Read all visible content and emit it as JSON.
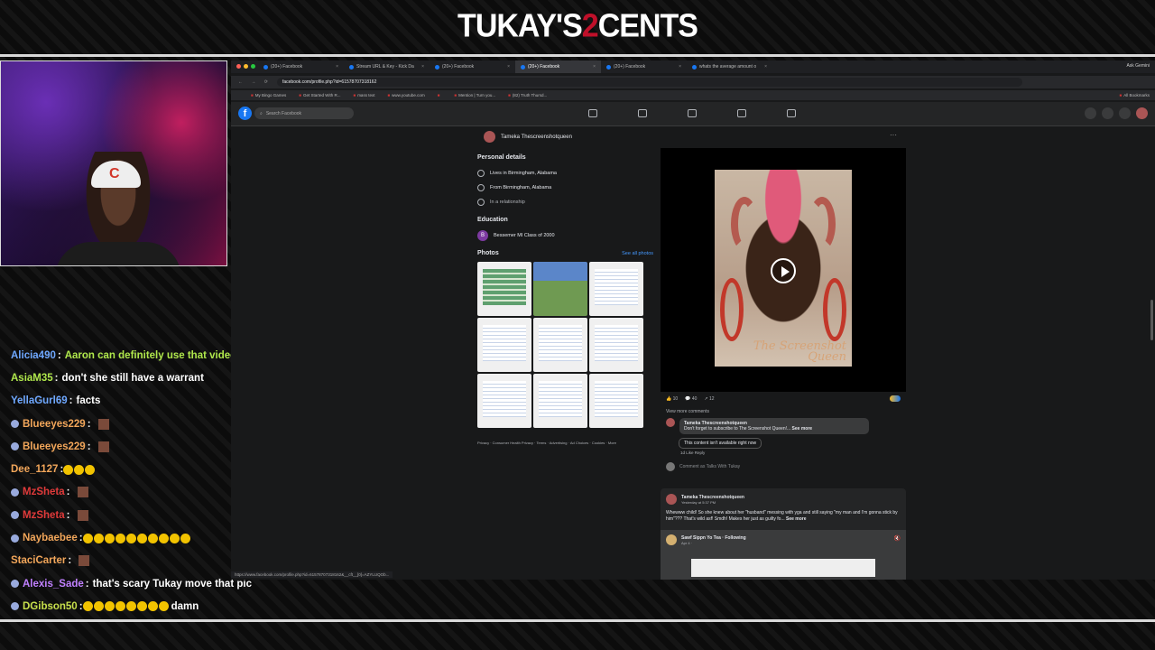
{
  "stream": {
    "title_part1": "TUKAY'S",
    "title_part2": "2",
    "title_part3": "CENTS",
    "webcam_cap_logo": "C"
  },
  "chat": [
    {
      "user": "Alicia490",
      "text": "Aaron can definitely use that video against her !!!!!!!!",
      "user_color": "#6fa8ff",
      "text_color": "#ffffff",
      "emoji_count": 0,
      "badge": false
    },
    {
      "user": "AsiaM35",
      "text": "don't she still have a warrant",
      "user_color": "#b0e84c",
      "emoji_count": 0,
      "badge": false
    },
    {
      "user": "YellaGurl69",
      "text": "facts",
      "user_color": "#6fa8ff",
      "emoji_count": 0,
      "badge": false
    },
    {
      "user": "Blueeyes229",
      "text": "",
      "user_color": "#f2a65a",
      "emoji_count": 0,
      "badge": true,
      "emote": true
    },
    {
      "user": "Blueeyes229",
      "text": "",
      "user_color": "#f2a65a",
      "emoji_count": 0,
      "badge": true,
      "emote": true
    },
    {
      "user": "Dee_1127",
      "text": "",
      "user_color": "#f2a65a",
      "emoji_count": 3,
      "badge": false
    },
    {
      "user": "MzSheta",
      "text": "",
      "user_color": "#e03a3a",
      "emoji_count": 0,
      "badge": true,
      "emote": true
    },
    {
      "user": "MzSheta",
      "text": "",
      "user_color": "#e03a3a",
      "emoji_count": 0,
      "badge": true,
      "emote": true
    },
    {
      "user": "Naybaebee",
      "text": "",
      "user_color": "#f2a65a",
      "emoji_count": 10,
      "badge": true
    },
    {
      "user": "StaciCarter",
      "text": "",
      "user_color": "#f2a65a",
      "emoji_count": 0,
      "badge": false,
      "emote": true
    },
    {
      "user": "Alexis_Sade",
      "text": "that's scary Tukay move that pic",
      "user_color": "#c080ff",
      "emoji_count": 0,
      "badge": true
    },
    {
      "user": "DGibson50",
      "text": "damn",
      "user_color": "#c8e04c",
      "emoji_count": 8,
      "badge": true
    }
  ],
  "browser": {
    "tabs": [
      {
        "label": "(20+) Facebook",
        "active": false
      },
      {
        "label": "Stream URL & Key - Kick Da",
        "active": false
      },
      {
        "label": "(20+) Facebook",
        "active": false
      },
      {
        "label": "(20+) Facebook",
        "active": true
      },
      {
        "label": "(20+) Facebook",
        "active": false
      },
      {
        "label": "whats the average amount o",
        "active": false
      }
    ],
    "ask_gemini": "Ask Gemini",
    "url": "facebook.com/profile.php?id=61578707318162",
    "bookmarks": [
      "My Bingo Games",
      "Get Started With R...",
      "mass text",
      "www.youtube.com",
      "",
      "Mention | Turn you...",
      "(82) Truth Thursd..."
    ],
    "all_bookmarks": "All Bookmarks",
    "status_url": "https://www.facebook.com/profile.php?id=61578707318162&__cft__[0]=AZYLUQOb..."
  },
  "facebook": {
    "logo": "f",
    "search_placeholder": "Search Facebook",
    "profile_name": "Tameka Thescreenshotqueen",
    "personal_details_title": "Personal details",
    "details": [
      "Lives in Birmingham, Alabama",
      "From Birmingham, Alabama",
      "In a relationship"
    ],
    "education_title": "Education",
    "education_badge": "B",
    "education": "Bessemer MI Class of 2000",
    "photos_title": "Photos",
    "see_all_photos": "See all photos",
    "footer": "Privacy · Consumer Health Privacy · Terms · Advertising · Ad Choices · Cookies · More",
    "video_watermark": "The Screenshot Queen",
    "stats": {
      "likes": "10",
      "comments": "40",
      "shares": "12"
    },
    "view_more_comments": "View more comments",
    "comment_author": "Tameka Thescreenshotqueen",
    "comment_text": "Don't forget to subscribe to The Screenshot Queen!...",
    "see_more": "See more",
    "unavailable": "This content isn't available right now",
    "comment_meta": "1d  Like  Reply",
    "comment_placeholder": "Comment as Talks With Tukay",
    "post2_author": "Tameka Thescreenshotqueen",
    "post2_date": "Yesterday at 5:37 PM",
    "post2_text": "Whewww child! So she knew about her \"husband\" messing with yga and still saying \"my man and I'm gonna stick by him\"??? That's wild asf! Smdh! Makes her just as guilty fo...",
    "post2_see_more": "See more",
    "shared_author": "Sawf Sippn Yo Tea · Following",
    "shared_date": "Apr 4 · "
  }
}
